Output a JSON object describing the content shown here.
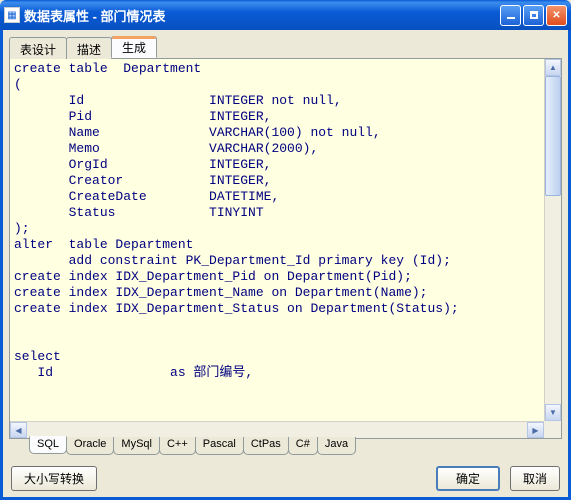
{
  "window": {
    "title": "数据表属性 - 部门情况表"
  },
  "topTabs": [
    {
      "label": "表设计"
    },
    {
      "label": "描述"
    },
    {
      "label": "生成"
    }
  ],
  "code": "create table  Department\n(\n       Id                INTEGER not null,\n       Pid               INTEGER,\n       Name              VARCHAR(100) not null,\n       Memo              VARCHAR(2000),\n       OrgId             INTEGER,\n       Creator           INTEGER,\n       CreateDate        DATETIME,\n       Status            TINYINT\n);\nalter  table Department\n       add constraint PK_Department_Id primary key (Id);\ncreate index IDX_Department_Pid on Department(Pid);\ncreate index IDX_Department_Name on Department(Name);\ncreate index IDX_Department_Status on Department(Status);\n\n\nselect\n   Id               as 部门编号,",
  "bottomTabs": [
    {
      "label": "SQL"
    },
    {
      "label": "Oracle"
    },
    {
      "label": "MySql"
    },
    {
      "label": "C++"
    },
    {
      "label": "Pascal"
    },
    {
      "label": "CtPas"
    },
    {
      "label": "C#"
    },
    {
      "label": "Java"
    }
  ],
  "buttons": {
    "caseConvert": "大小写转换",
    "ok": "确定",
    "cancel": "取消"
  }
}
